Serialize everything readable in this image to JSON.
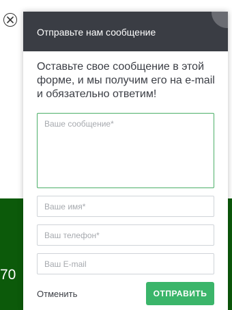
{
  "background": {
    "number_text": "70",
    "band_color": "#0c5a0a"
  },
  "dialog": {
    "title": "Отправьте нам сообщение",
    "intro": "Оставьте свое сообщение в этой форме, и мы получим его на e-mail и обязательно ответим!",
    "message_placeholder": "Ваше сообщение*",
    "name_placeholder": "Ваше имя*",
    "phone_placeholder": "Ваш телефон*",
    "email_placeholder": "Ваш E-mail",
    "cancel_label": "Отменить",
    "send_label": "ОТПРАВИТЬ",
    "header_color": "#3a3d44",
    "accent_color": "#3bb56a"
  },
  "icons": {
    "close": "close-icon"
  }
}
